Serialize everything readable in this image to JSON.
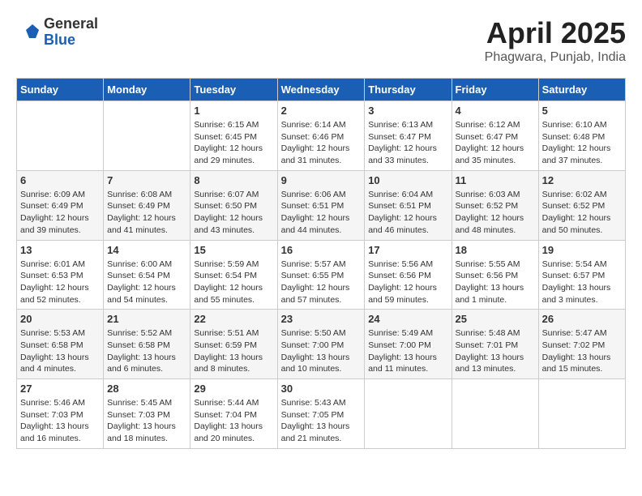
{
  "header": {
    "logo_general": "General",
    "logo_blue": "Blue",
    "month": "April 2025",
    "location": "Phagwara, Punjab, India"
  },
  "columns": [
    "Sunday",
    "Monday",
    "Tuesday",
    "Wednesday",
    "Thursday",
    "Friday",
    "Saturday"
  ],
  "weeks": [
    [
      {
        "day": "",
        "info": ""
      },
      {
        "day": "",
        "info": ""
      },
      {
        "day": "1",
        "info": "Sunrise: 6:15 AM\nSunset: 6:45 PM\nDaylight: 12 hours and 29 minutes."
      },
      {
        "day": "2",
        "info": "Sunrise: 6:14 AM\nSunset: 6:46 PM\nDaylight: 12 hours and 31 minutes."
      },
      {
        "day": "3",
        "info": "Sunrise: 6:13 AM\nSunset: 6:47 PM\nDaylight: 12 hours and 33 minutes."
      },
      {
        "day": "4",
        "info": "Sunrise: 6:12 AM\nSunset: 6:47 PM\nDaylight: 12 hours and 35 minutes."
      },
      {
        "day": "5",
        "info": "Sunrise: 6:10 AM\nSunset: 6:48 PM\nDaylight: 12 hours and 37 minutes."
      }
    ],
    [
      {
        "day": "6",
        "info": "Sunrise: 6:09 AM\nSunset: 6:49 PM\nDaylight: 12 hours and 39 minutes."
      },
      {
        "day": "7",
        "info": "Sunrise: 6:08 AM\nSunset: 6:49 PM\nDaylight: 12 hours and 41 minutes."
      },
      {
        "day": "8",
        "info": "Sunrise: 6:07 AM\nSunset: 6:50 PM\nDaylight: 12 hours and 43 minutes."
      },
      {
        "day": "9",
        "info": "Sunrise: 6:06 AM\nSunset: 6:51 PM\nDaylight: 12 hours and 44 minutes."
      },
      {
        "day": "10",
        "info": "Sunrise: 6:04 AM\nSunset: 6:51 PM\nDaylight: 12 hours and 46 minutes."
      },
      {
        "day": "11",
        "info": "Sunrise: 6:03 AM\nSunset: 6:52 PM\nDaylight: 12 hours and 48 minutes."
      },
      {
        "day": "12",
        "info": "Sunrise: 6:02 AM\nSunset: 6:52 PM\nDaylight: 12 hours and 50 minutes."
      }
    ],
    [
      {
        "day": "13",
        "info": "Sunrise: 6:01 AM\nSunset: 6:53 PM\nDaylight: 12 hours and 52 minutes."
      },
      {
        "day": "14",
        "info": "Sunrise: 6:00 AM\nSunset: 6:54 PM\nDaylight: 12 hours and 54 minutes."
      },
      {
        "day": "15",
        "info": "Sunrise: 5:59 AM\nSunset: 6:54 PM\nDaylight: 12 hours and 55 minutes."
      },
      {
        "day": "16",
        "info": "Sunrise: 5:57 AM\nSunset: 6:55 PM\nDaylight: 12 hours and 57 minutes."
      },
      {
        "day": "17",
        "info": "Sunrise: 5:56 AM\nSunset: 6:56 PM\nDaylight: 12 hours and 59 minutes."
      },
      {
        "day": "18",
        "info": "Sunrise: 5:55 AM\nSunset: 6:56 PM\nDaylight: 13 hours and 1 minute."
      },
      {
        "day": "19",
        "info": "Sunrise: 5:54 AM\nSunset: 6:57 PM\nDaylight: 13 hours and 3 minutes."
      }
    ],
    [
      {
        "day": "20",
        "info": "Sunrise: 5:53 AM\nSunset: 6:58 PM\nDaylight: 13 hours and 4 minutes."
      },
      {
        "day": "21",
        "info": "Sunrise: 5:52 AM\nSunset: 6:58 PM\nDaylight: 13 hours and 6 minutes."
      },
      {
        "day": "22",
        "info": "Sunrise: 5:51 AM\nSunset: 6:59 PM\nDaylight: 13 hours and 8 minutes."
      },
      {
        "day": "23",
        "info": "Sunrise: 5:50 AM\nSunset: 7:00 PM\nDaylight: 13 hours and 10 minutes."
      },
      {
        "day": "24",
        "info": "Sunrise: 5:49 AM\nSunset: 7:00 PM\nDaylight: 13 hours and 11 minutes."
      },
      {
        "day": "25",
        "info": "Sunrise: 5:48 AM\nSunset: 7:01 PM\nDaylight: 13 hours and 13 minutes."
      },
      {
        "day": "26",
        "info": "Sunrise: 5:47 AM\nSunset: 7:02 PM\nDaylight: 13 hours and 15 minutes."
      }
    ],
    [
      {
        "day": "27",
        "info": "Sunrise: 5:46 AM\nSunset: 7:03 PM\nDaylight: 13 hours and 16 minutes."
      },
      {
        "day": "28",
        "info": "Sunrise: 5:45 AM\nSunset: 7:03 PM\nDaylight: 13 hours and 18 minutes."
      },
      {
        "day": "29",
        "info": "Sunrise: 5:44 AM\nSunset: 7:04 PM\nDaylight: 13 hours and 20 minutes."
      },
      {
        "day": "30",
        "info": "Sunrise: 5:43 AM\nSunset: 7:05 PM\nDaylight: 13 hours and 21 minutes."
      },
      {
        "day": "",
        "info": ""
      },
      {
        "day": "",
        "info": ""
      },
      {
        "day": "",
        "info": ""
      }
    ]
  ]
}
